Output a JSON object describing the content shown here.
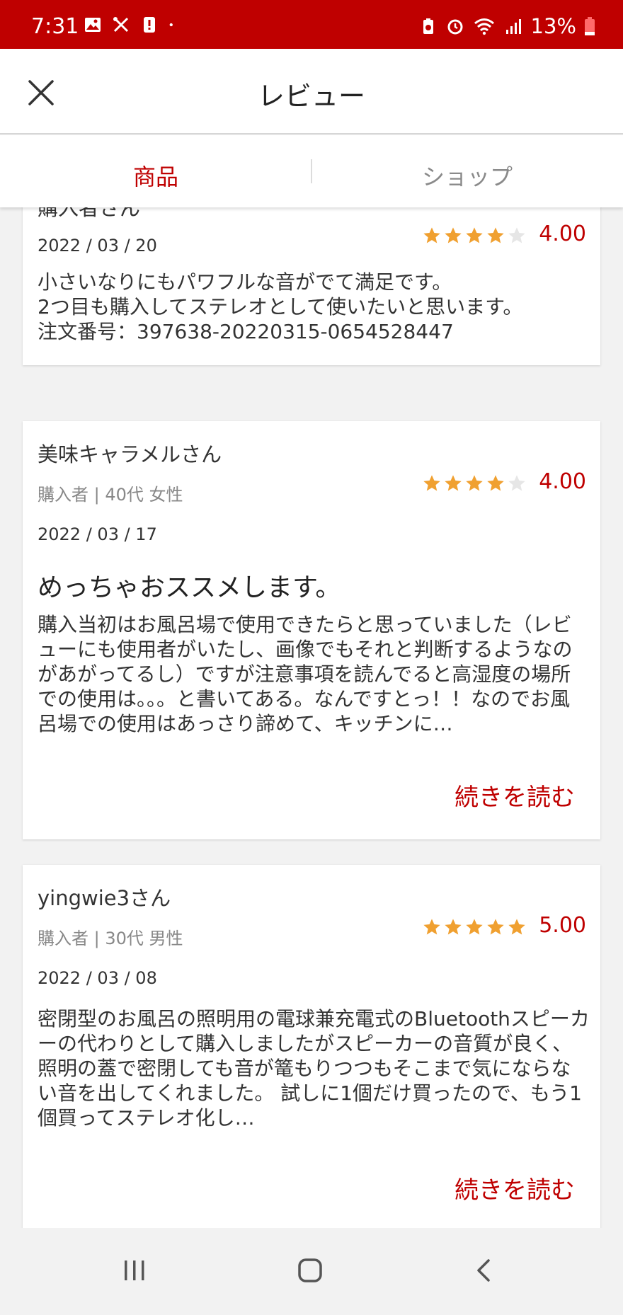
{
  "status_bar": {
    "time": "7:31",
    "battery": "13%",
    "icons_left": [
      "image-icon",
      "tools-icon",
      "alert-icon",
      "dot-icon"
    ],
    "icons_right": [
      "battery-saver-icon",
      "alarm-icon",
      "wifi-icon",
      "signal-icon",
      "battery-icon"
    ]
  },
  "header": {
    "title": "レビュー"
  },
  "tabs": [
    {
      "label": "商品",
      "active": true
    },
    {
      "label": "ショップ",
      "active": false
    }
  ],
  "colors": {
    "accent": "#bf0000",
    "star_filled": "#f0a030",
    "star_empty": "#e6e6e6"
  },
  "reviews": [
    {
      "name": "購入者さん",
      "date": "2022 / 03 / 20",
      "rating": 4,
      "score": "4.00",
      "body": "小さいなりにもパワフルな音がでて満足です。\n2つ目も購入してステレオとして使いたいと思います。\n注文番号：397638-20220315-0654528447"
    },
    {
      "name": "美味キャラメルさん",
      "meta": "購入者 | 40代 女性",
      "date": "2022 / 03 / 17",
      "rating": 4,
      "score": "4.00",
      "title": "めっちゃおススメします。",
      "body": "購入当初はお風呂場で使用できたらと思っていました（レビューにも使用者がいたし、画像でもそれと判断するようなのがあがってるし）ですが注意事項を読んでると高湿度の場所での使用は。。。と書いてある。なんですとっ！！なのでお風呂場での使用はあっさり諦めて、キッチンに…",
      "read_more": "続きを読む"
    },
    {
      "name": "yingwie3さん",
      "meta": "購入者 | 30代 男性",
      "date": "2022 / 03 / 08",
      "rating": 5,
      "score": "5.00",
      "body": "密閉型のお風呂の照明用の電球兼充電式のBluetoothスピーカーの代わりとして購入しましたがスピーカーの音質が良く、照明の蓋で密閉しても音が篭もりつつもそこまで気にならない音を出してくれました。\n試しに1個だけ買ったので、もう1個買ってステレオ化し…",
      "read_more": "続きを読む"
    }
  ]
}
